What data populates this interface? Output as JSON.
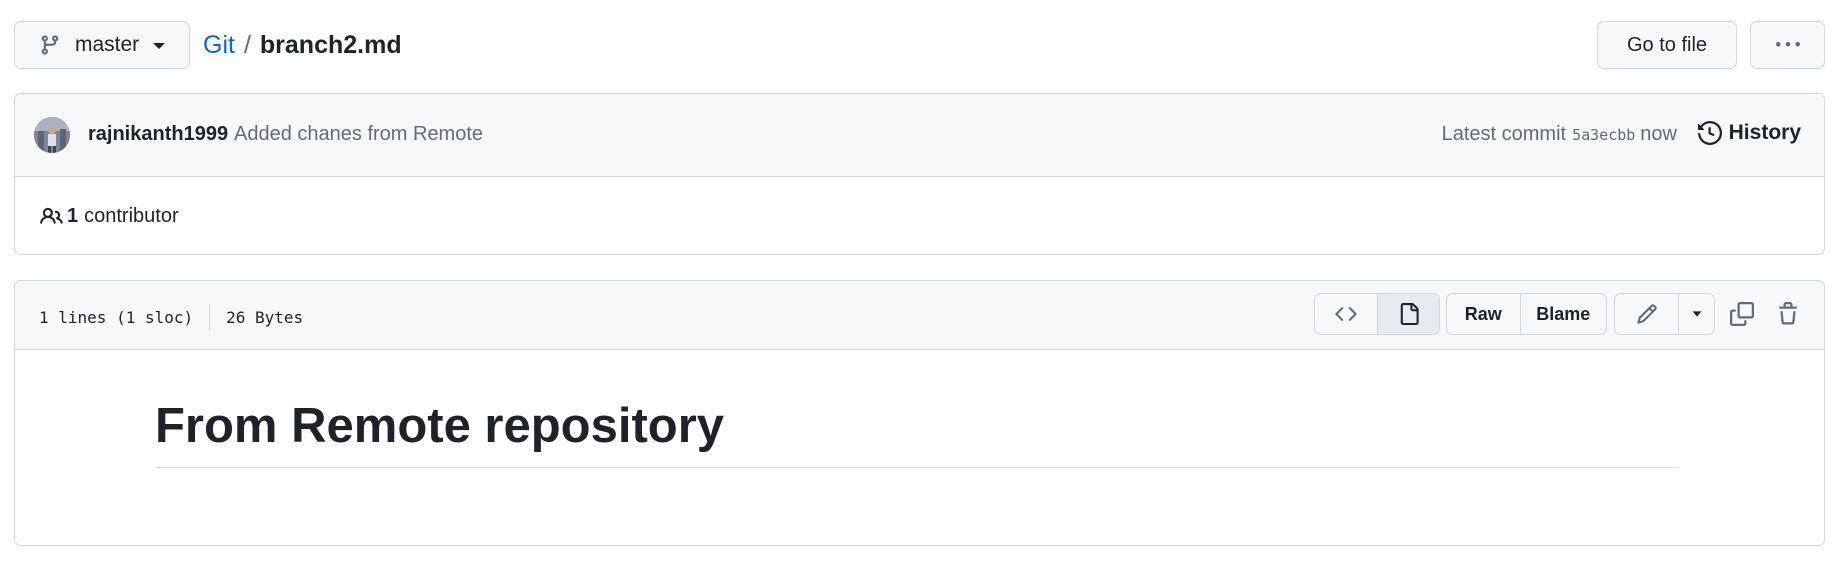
{
  "topbar": {
    "branch": "master",
    "repo": "Git",
    "separator": "/",
    "file": "branch2.md",
    "goto_file": "Go to file"
  },
  "commit": {
    "author": "rajnikanth1999",
    "message": "Added chanes from Remote",
    "latest_label": "Latest commit",
    "sha": "5a3ecbb",
    "time": "now",
    "history": "History"
  },
  "contributors": {
    "count": "1",
    "label": "contributor"
  },
  "file": {
    "lines": "1 lines (1 sloc)",
    "size": "26 Bytes",
    "raw": "Raw",
    "blame": "Blame"
  },
  "content": {
    "heading": "From Remote repository"
  },
  "colors": {
    "link": "#0969da",
    "muted": "#636c76",
    "border": "#d0d7de",
    "header_bg": "#f6f8fa"
  }
}
